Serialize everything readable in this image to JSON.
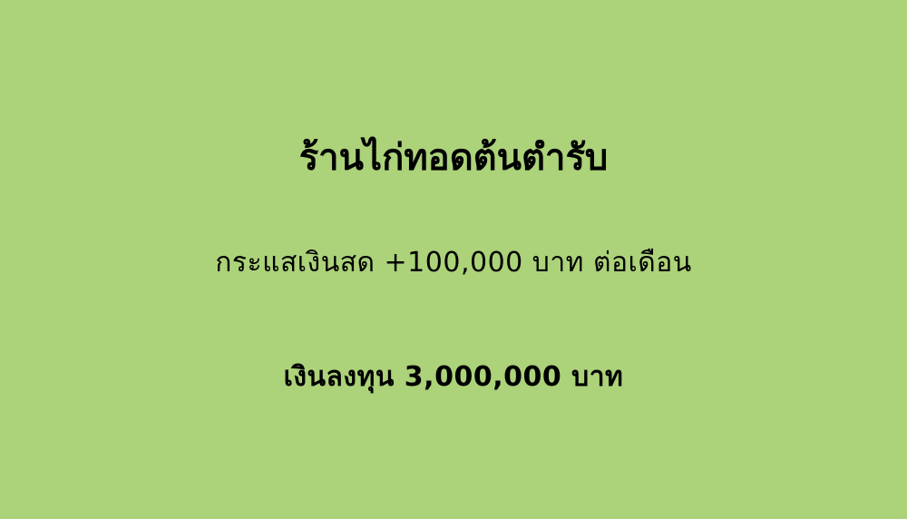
{
  "card": {
    "background_color": "#acd27a",
    "text_color": "#000000",
    "title": "ร้านไก่ทอดต้นตำรับ",
    "cash_flow_text": "กระแสเงินสด +100,000 บาท ต่อเดือน",
    "investment_text": "เงินลงทุน 3,000,000 บาท"
  }
}
